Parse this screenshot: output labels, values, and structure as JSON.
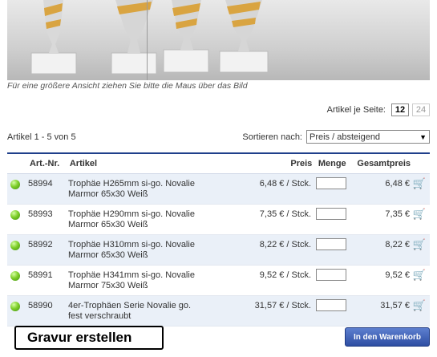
{
  "caption": "Für eine größere Ansicht ziehen Sie bitte die Maus über das Bild",
  "per_page": {
    "label": "Artikel je Seite:",
    "options": [
      "12",
      "24"
    ],
    "selected": "12"
  },
  "count_text": "Artikel 1 - 5 von 5",
  "sort": {
    "label": "Sortieren nach:",
    "value": "Preis / absteigend"
  },
  "table": {
    "headers": {
      "nr": "Art.-Nr.",
      "article": "Artikel",
      "price": "Preis",
      "qty": "Menge",
      "total": "Gesamtpreis"
    },
    "rows": [
      {
        "nr": "58994",
        "line1": "Trophäe H265mm si-go. Novalie",
        "line2": "Marmor 65x30 Weiß",
        "price": "6,48 € / Stck.",
        "total": "6,48 €"
      },
      {
        "nr": "58993",
        "line1": "Trophäe H290mm si-go. Novalie",
        "line2": "Marmor 65x30 Weiß",
        "price": "7,35 € / Stck.",
        "total": "7,35 €"
      },
      {
        "nr": "58992",
        "line1": "Trophäe H310mm si-go. Novalie",
        "line2": "Marmor 65x30 Weiß",
        "price": "8,22 € / Stck.",
        "total": "8,22 €"
      },
      {
        "nr": "58991",
        "line1": "Trophäe H341mm si-go. Novalie",
        "line2": "Marmor 75x30 Weiß",
        "price": "9,52 € / Stck.",
        "total": "9,52 €"
      },
      {
        "nr": "58990",
        "line1": "4er-Trophäen Serie Novalie go.",
        "line2": "fest verschraubt",
        "price": "31,57 € / Stck.",
        "total": "31,57 €"
      }
    ]
  },
  "footer": {
    "gravur_label": "Gravur erstellen",
    "cart_button": "In den Warenkorb"
  },
  "colors": {
    "header_rule": "#1f3f8b",
    "row_alt": "#eaf0f8",
    "button": "#2e4ea3"
  }
}
